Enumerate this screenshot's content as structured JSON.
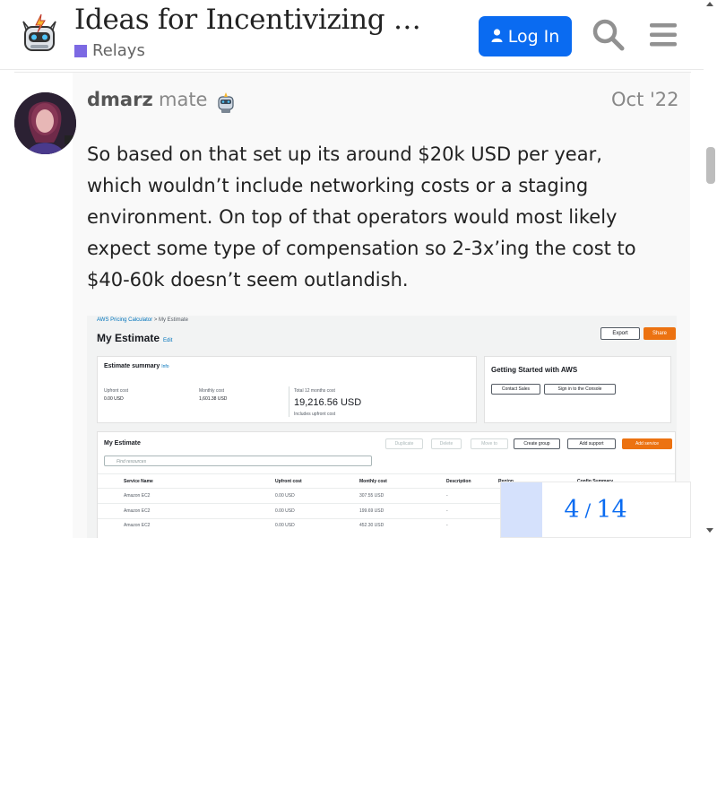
{
  "header": {
    "title": "Ideas for Incentivizing Relays",
    "category": "Relays",
    "login_label": "Log In",
    "category_color": "#7c69e3",
    "accent": "#0a6bf1"
  },
  "post": {
    "username": "dmarz",
    "user_title": "mate",
    "date": "Oct '22",
    "body": "So based on that set up its around $20k USD per year, which wouldn’t include networking costs or a staging environment. On top of that operators would most likely expect some type of compensation so 2-3x’ing the cost to $40-60k doesn’t seem outlandish."
  },
  "aws_image": {
    "breadcrumb_root": "AWS Pricing Calculator",
    "breadcrumb_sep": ">",
    "breadcrumb_current": "My Estimate",
    "heading": "My Estimate",
    "edit": "Edit",
    "export": "Export",
    "share": "Share",
    "summary_title": "Estimate summary",
    "summary_info": "Info",
    "upfront_label": "Upfront cost",
    "upfront_value": "0.00 USD",
    "monthly_label": "Monthly cost",
    "monthly_value": "1,601.38 USD",
    "total_label": "Total 12 months cost",
    "total_value": "19,216.56 USD",
    "total_note": "Includes upfront cost",
    "getting_started": "Getting Started with AWS",
    "contact_sales": "Contact Sales",
    "sign_in": "Sign in to the Console",
    "estimate_title": "My Estimate",
    "btn_duplicate": "Duplicate",
    "btn_delete": "Delete",
    "btn_move": "Move to",
    "btn_create_group": "Create group",
    "btn_add_support": "Add support",
    "btn_add_service": "Add service",
    "search_placeholder": "Find resources",
    "columns": [
      "Service Name",
      "Upfront cost",
      "Monthly cost",
      "Description",
      "Region",
      "Config Summary"
    ],
    "rows": [
      {
        "service": "Amazon EC2",
        "upfront": "0.00 USD",
        "monthly": "307.55 USD",
        "desc": "-"
      },
      {
        "service": "Amazon EC2",
        "upfront": "0.00 USD",
        "monthly": "199.69 USD",
        "desc": "-"
      },
      {
        "service": "Amazon EC2",
        "upfront": "0.00 USD",
        "monthly": "452.30 USD",
        "desc": "-"
      }
    ]
  },
  "progress": {
    "current": "4",
    "separator": "/",
    "total": "14",
    "fraction": 0.2857
  }
}
